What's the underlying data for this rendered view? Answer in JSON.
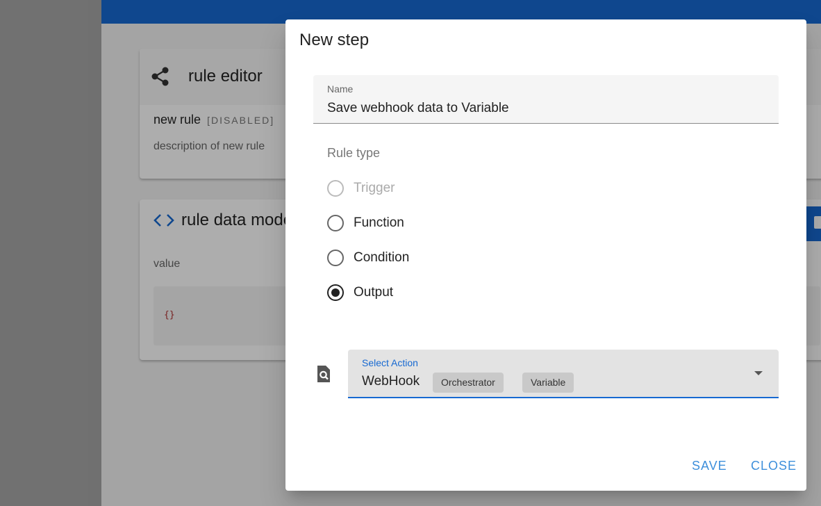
{
  "background": {
    "editor_card": {
      "title": "rule editor",
      "rule_name": "new rule",
      "rule_status": "[DISABLED]",
      "rule_description": "description of new rule"
    },
    "data_card": {
      "title": "rule data model",
      "value_label": "value",
      "code": "{}"
    }
  },
  "dialog": {
    "title": "New step",
    "name_field": {
      "label": "Name",
      "value": "Save webhook data to Variable"
    },
    "rule_type": {
      "label": "Rule type",
      "options": [
        {
          "label": "Trigger",
          "disabled": true,
          "checked": false
        },
        {
          "label": "Function",
          "disabled": false,
          "checked": false
        },
        {
          "label": "Condition",
          "disabled": false,
          "checked": false
        },
        {
          "label": "Output",
          "disabled": false,
          "checked": true
        }
      ]
    },
    "action_select": {
      "label": "Select Action",
      "value": "WebHook",
      "chips": [
        "Orchestrator",
        "Variable"
      ]
    },
    "buttons": {
      "save": "SAVE",
      "close": "CLOSE"
    }
  },
  "colors": {
    "primary": "#1769d1",
    "button_text": "#3d8fdb"
  }
}
